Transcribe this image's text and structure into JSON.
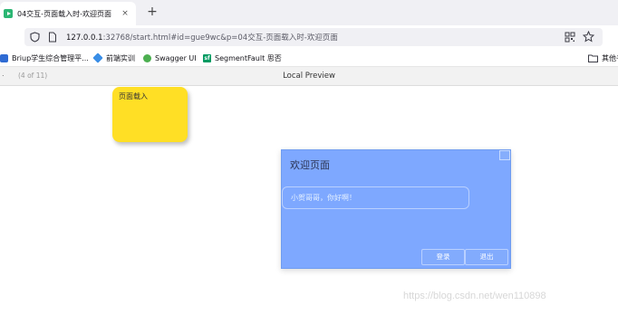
{
  "browser": {
    "tab": {
      "title": "04交互-页面载入时-欢迎页面",
      "close": "×"
    },
    "new_tab": "+",
    "url": {
      "host": "127.0.0.1",
      "rest": ":32768/start.html#id=gue9wc&p=04交互-页面载入时-欢迎页面"
    },
    "bookmarks": [
      {
        "label": "Briup学生综合管理平...",
        "icon": "briup-icon"
      },
      {
        "label": "前端实训",
        "icon": "diamond-icon"
      },
      {
        "label": "Swagger UI",
        "icon": "swagger-icon"
      },
      {
        "label": "SegmentFault 思否",
        "icon": "sf-icon",
        "badge": "sf"
      }
    ],
    "other_bookmarks": "其他书"
  },
  "preview_bar": {
    "pager": "(4 of 11)",
    "title": "Local Preview"
  },
  "page": {
    "sticky_note": {
      "text": "页面载入",
      "color": "#ffdf25"
    },
    "dialog": {
      "title": "欢迎页面",
      "message": "小贺哥哥，你好啊！",
      "buttons": {
        "login": "登录",
        "exit": "退出"
      },
      "background": "#7ea8ff"
    }
  },
  "watermark": "https://blog.csdn.net/wen110898"
}
